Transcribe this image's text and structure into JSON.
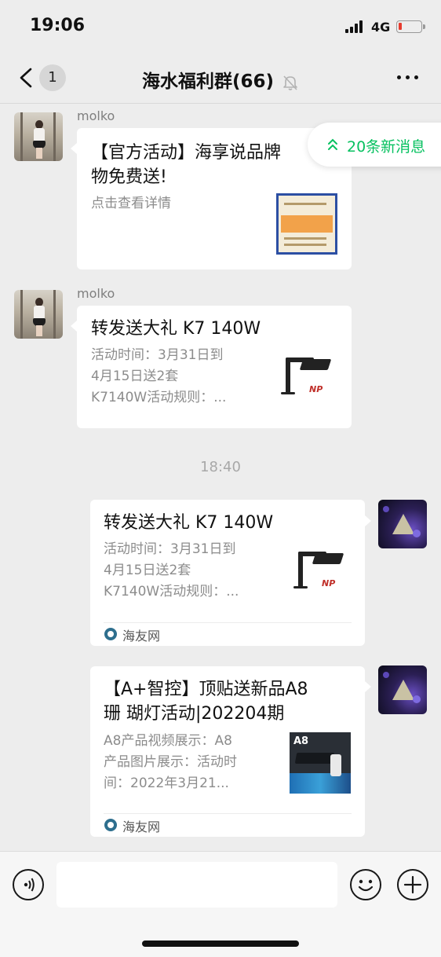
{
  "status_bar": {
    "time": "19:06",
    "network": "4G",
    "battery_level": 0.1
  },
  "nav": {
    "back_badge": "1",
    "title": "海水福利群(66)",
    "muted_icon": "bell-slash-icon",
    "more_icon": "more-icon"
  },
  "new_messages": {
    "label": "20条新消息"
  },
  "messages": [
    {
      "sender": "molko",
      "title_lines": [
        "【官方活动】海享说品牌",
        "物免费送!"
      ],
      "desc_lines": [
        "点击查看详情"
      ],
      "thumb_icon": "document-thumbnail"
    },
    {
      "sender": "molko",
      "title_lines": [
        "转发送大礼 K7 140W"
      ],
      "desc_lines": [
        "活动时间：3月31日到",
        "4月15日送2套",
        "K7140W活动规则：..."
      ],
      "thumb_icon": "lamp-thumbnail"
    },
    {
      "sender": "",
      "title_lines": [
        "转发送大礼 K7 140W"
      ],
      "desc_lines": [
        "活动时间：3月31日到",
        "4月15日送2套",
        "K7140W活动规则：..."
      ],
      "thumb_icon": "lamp-thumbnail",
      "source": "海友网"
    },
    {
      "sender": "",
      "title_lines": [
        "【A+智控】顶贴送新品A8",
        "珊 瑚灯活动|202204期"
      ],
      "desc_lines": [
        "A8产品视频展示：A8",
        "产品图片展示：活动时",
        "间：2022年3月21..."
      ],
      "thumb_icon": "a8-thumbnail",
      "thumb_text": "A8",
      "source": "海友网"
    }
  ],
  "time_divider": "18:40",
  "thumb_brand": "NP",
  "input_bar": {
    "voice_icon": "voice-icon",
    "emoji_icon": "emoji-icon",
    "add_icon": "plus-icon"
  },
  "colors": {
    "accent_green": "#07c160",
    "background": "#ededed",
    "bubble": "#ffffff"
  }
}
